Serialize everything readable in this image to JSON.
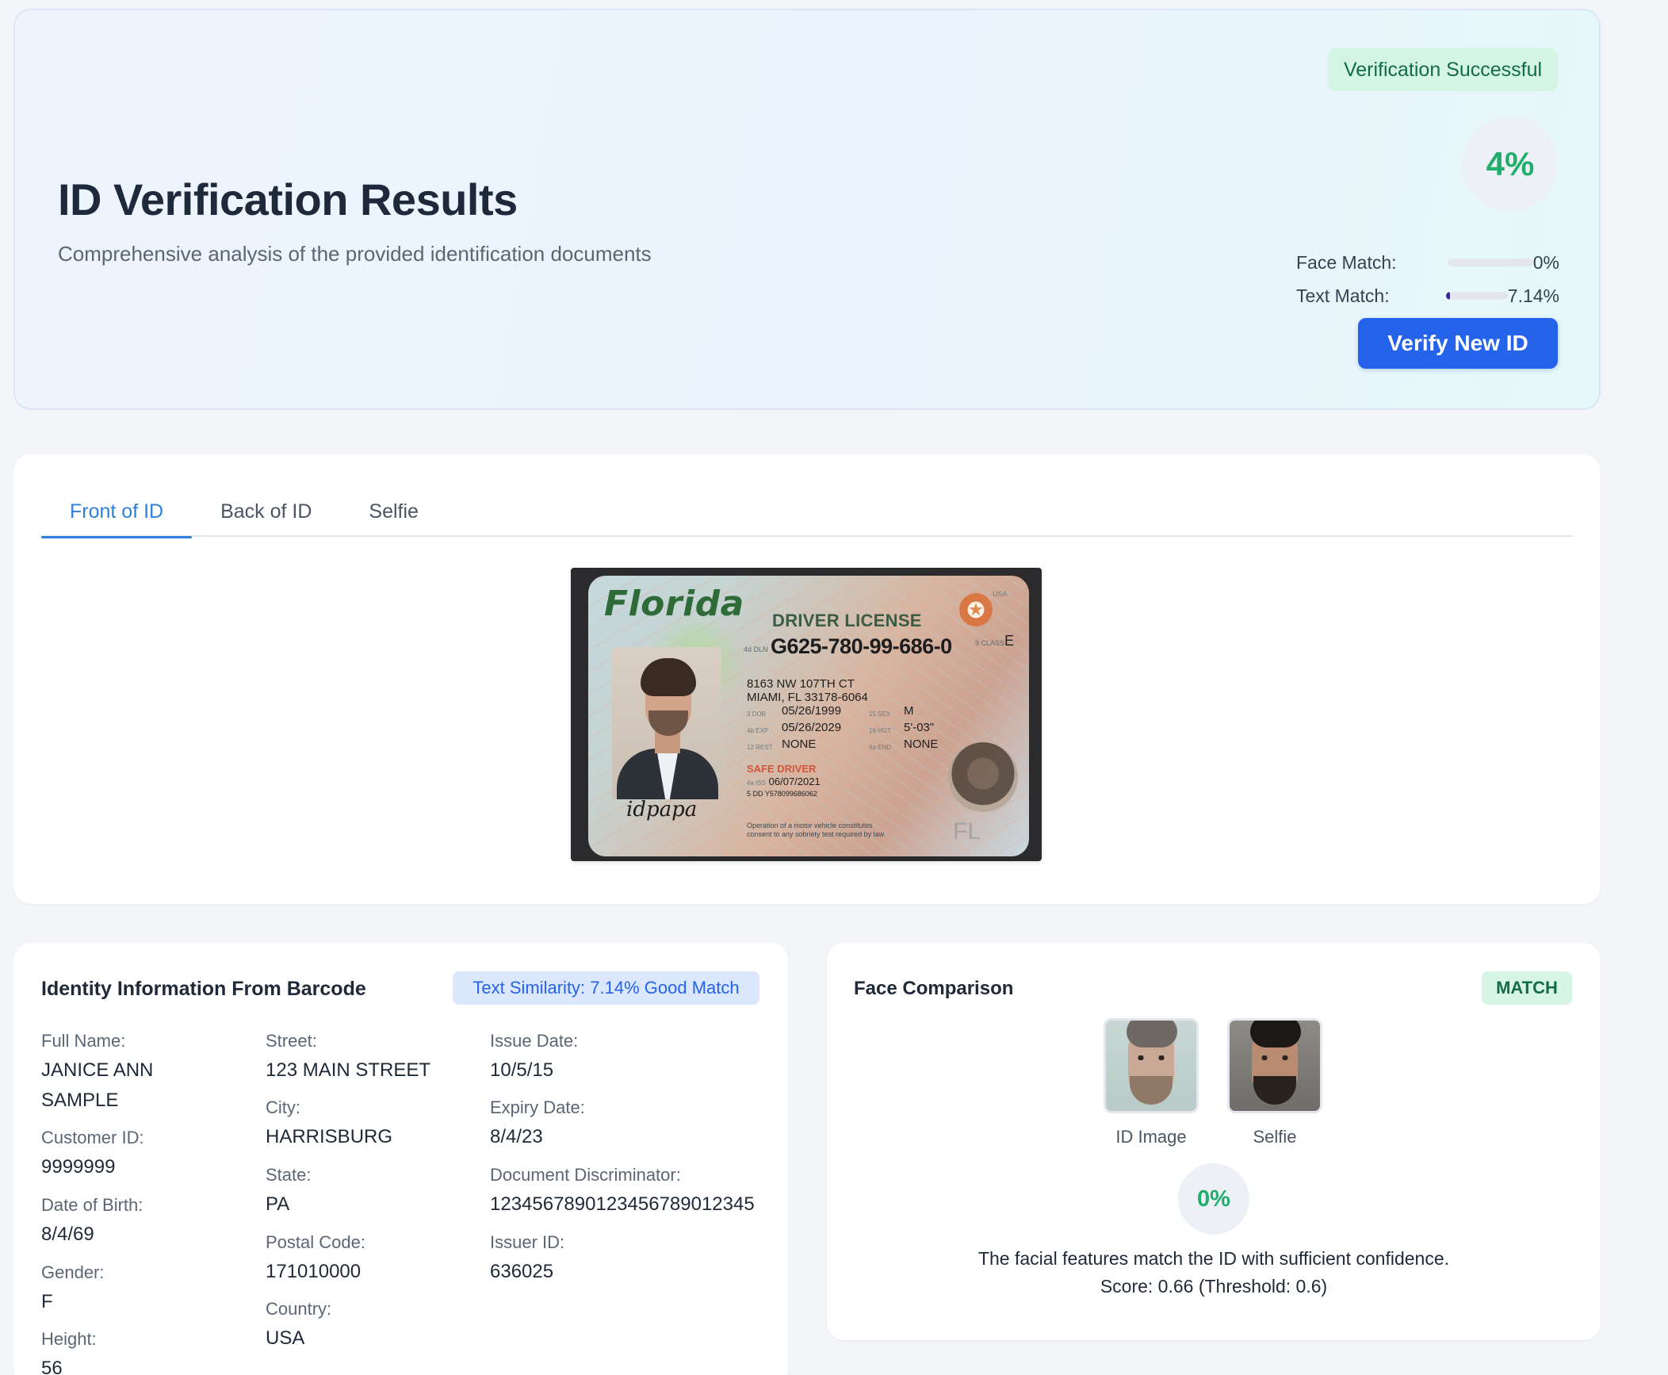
{
  "header": {
    "title": "ID Verification Results",
    "subtitle": "Comprehensive analysis of the provided identification documents",
    "status": "Verification Successful",
    "overall_score": "4%",
    "metrics": [
      {
        "label": "Face Match:",
        "value": "0%",
        "fraction": 0.0
      },
      {
        "label": "Text Match:",
        "value": "7.14%",
        "fraction": 0.0714
      }
    ],
    "verify_button": "Verify New ID"
  },
  "tabs": [
    {
      "label": "Front of ID",
      "active": true
    },
    {
      "label": "Back of ID",
      "active": false
    },
    {
      "label": "Selfie",
      "active": false
    }
  ],
  "id_card": {
    "state": "Florida",
    "type": "DRIVER LICENSE",
    "number_tag": "4d DLN",
    "number": "G625-780-99-686-0",
    "class_tag": "9 CLASS",
    "class": "E",
    "usa": "USA",
    "address1": "8163 NW 107TH CT",
    "address2": "MIAMI, FL 33178-6064",
    "dob_tag": "3 DOB",
    "dob": "05/26/1999",
    "sex_tag": "15 SEX",
    "sex": "M",
    "exp_tag": "4b EXP",
    "exp": "05/26/2029",
    "hgt_tag": "16 HGT",
    "hgt": "5'-03\"",
    "rest_tag": "12 REST",
    "rest": "NONE",
    "end_tag": "9a END",
    "end": "NONE",
    "safe_driver": "SAFE DRIVER",
    "iss_tag": "4a ISS",
    "iss": "06/07/2021",
    "dd": "5 DD  Y578099686062",
    "signature": "idpapa",
    "disclaimer1": "Operation of a motor vehicle constitutes",
    "disclaimer2": "consent to any sobriety test required by law",
    "fl": "FL"
  },
  "identity": {
    "title": "Identity Information From Barcode",
    "similarity": "Text Similarity: 7.14% Good Match",
    "fields": [
      {
        "label": "Full Name:",
        "value": "JANICE ANN SAMPLE"
      },
      {
        "label": "Customer ID:",
        "value": "9999999"
      },
      {
        "label": "Date of Birth:",
        "value": "8/4/69"
      },
      {
        "label": "Gender:",
        "value": "F"
      },
      {
        "label": "Height:",
        "value": "56"
      },
      {
        "label": "Street:",
        "value": "123 MAIN STREET"
      },
      {
        "label": "City:",
        "value": "HARRISBURG"
      },
      {
        "label": "State:",
        "value": "PA"
      },
      {
        "label": "Postal Code:",
        "value": "171010000"
      },
      {
        "label": "Country:",
        "value": "USA"
      },
      {
        "label": "Issue Date:",
        "value": "10/5/15"
      },
      {
        "label": "Expiry Date:",
        "value": "8/4/23"
      },
      {
        "label": "Document Discriminator:",
        "value": "1234567890123456789012345"
      },
      {
        "label": "Issuer ID:",
        "value": "636025"
      }
    ]
  },
  "face": {
    "title": "Face Comparison",
    "status": "MATCH",
    "id_label": "ID Image",
    "selfie_label": "Selfie",
    "score": "0%",
    "message": "The facial features match the ID with sufficient confidence.",
    "detail": "Score: 0.66 (Threshold: 0.6)"
  },
  "colors": {
    "accent": "#2563eb",
    "success": "#1fae6b",
    "tab_active": "#2f80d8"
  }
}
